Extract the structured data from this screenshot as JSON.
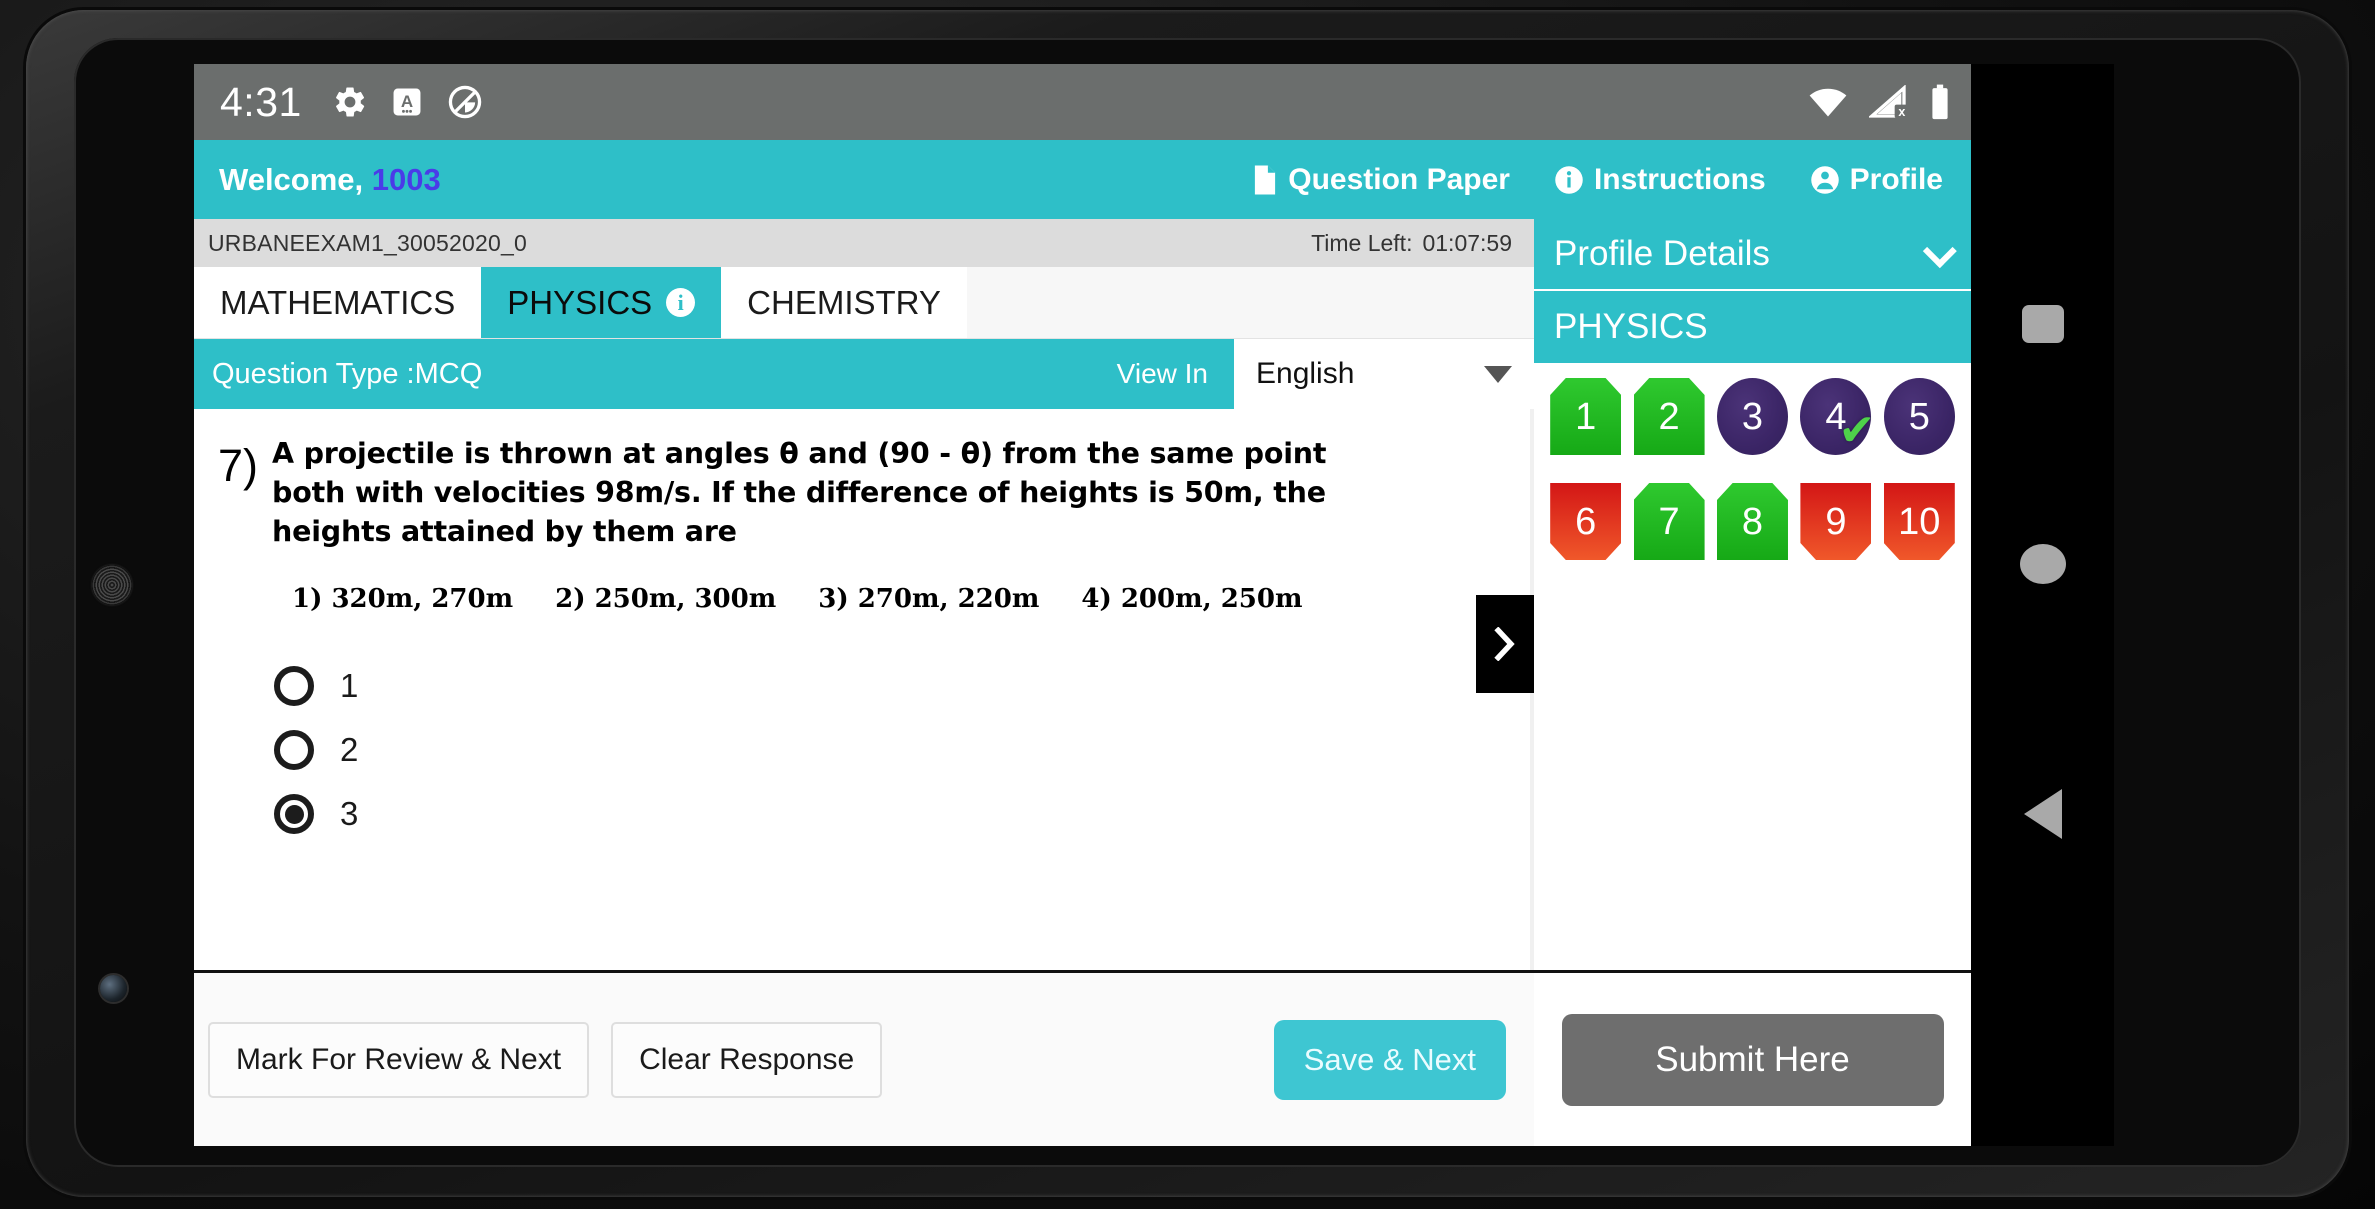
{
  "status_bar": {
    "clock": "4:31",
    "left_icons": [
      "gear-icon",
      "a-box-icon",
      "circle-slash-icon"
    ],
    "right_icons": [
      "wifi-icon",
      "signal-off-icon",
      "battery-full-icon"
    ]
  },
  "header": {
    "welcome_label": "Welcome,",
    "user_id": "1003",
    "actions": [
      {
        "icon": "document-icon",
        "label": "Question Paper"
      },
      {
        "icon": "info-icon",
        "label": "Instructions"
      },
      {
        "icon": "person-icon",
        "label": "Profile"
      }
    ]
  },
  "exam_bar": {
    "exam_id": "URBANEEXAM1_30052020_0",
    "time_left_label": "Time Left:",
    "time_left_value": "01:07:59"
  },
  "tabs": [
    {
      "label": "MATHEMATICS",
      "active": false,
      "has_info": false
    },
    {
      "label": "PHYSICS",
      "active": true,
      "has_info": true
    },
    {
      "label": "CHEMISTRY",
      "active": false,
      "has_info": false
    }
  ],
  "question_type_bar": {
    "question_type": "Question Type :MCQ",
    "view_in_label": "View In",
    "language_selected": "English",
    "language_options": [
      "English"
    ]
  },
  "question": {
    "number": "7)",
    "stem": "A projectile is thrown at angles θ and (90 - θ) from the same point both with velocities 98m/s.  If the difference of heights is 50m, the heights attained by them are",
    "inline_options": [
      "1) 320m, 270m",
      "2) 250m, 300m",
      "3) 270m, 220m",
      "4) 200m, 250m"
    ],
    "choices": [
      {
        "label": "1",
        "selected": false
      },
      {
        "label": "2",
        "selected": false
      },
      {
        "label": "3",
        "selected": true
      }
    ],
    "next_arrow_icon": "chevron-right-icon"
  },
  "action_bar": {
    "mark_review_label": "Mark For Review & Next",
    "clear_response_label": "Clear Response",
    "save_next_label": "Save & Next"
  },
  "palette": {
    "profile_details_label": "Profile Details",
    "profile_details_icon": "chevron-down-icon",
    "subject_label": "PHYSICS",
    "questions": [
      {
        "number": "1",
        "state": "answered",
        "marked": false
      },
      {
        "number": "2",
        "state": "answered",
        "marked": false
      },
      {
        "number": "3",
        "state": "not-visited",
        "marked": false
      },
      {
        "number": "4",
        "state": "not-visited",
        "marked": true
      },
      {
        "number": "5",
        "state": "not-visited",
        "marked": false
      },
      {
        "number": "6",
        "state": "unanswered",
        "marked": false
      },
      {
        "number": "7",
        "state": "answered",
        "marked": false
      },
      {
        "number": "8",
        "state": "answered",
        "marked": false
      },
      {
        "number": "9",
        "state": "unanswered",
        "marked": false
      },
      {
        "number": "10",
        "state": "unanswered",
        "marked": false
      }
    ],
    "marked_tick_glyph": "✔",
    "submit_label": "Submit Here"
  },
  "nav_bar": {
    "recents_icon": "square-icon",
    "home_icon": "circle-icon",
    "back_icon": "triangle-left-icon"
  },
  "colors": {
    "teal": "#2ebfc8",
    "user_id_blue": "#4a3ce8",
    "answered_green": "#1fb81f",
    "unanswered_red": "#d62d1c",
    "not_visited_purple": "#3b2566",
    "submit_gray": "#6e6e6e",
    "status_bar_gray": "#6b6e6d"
  }
}
